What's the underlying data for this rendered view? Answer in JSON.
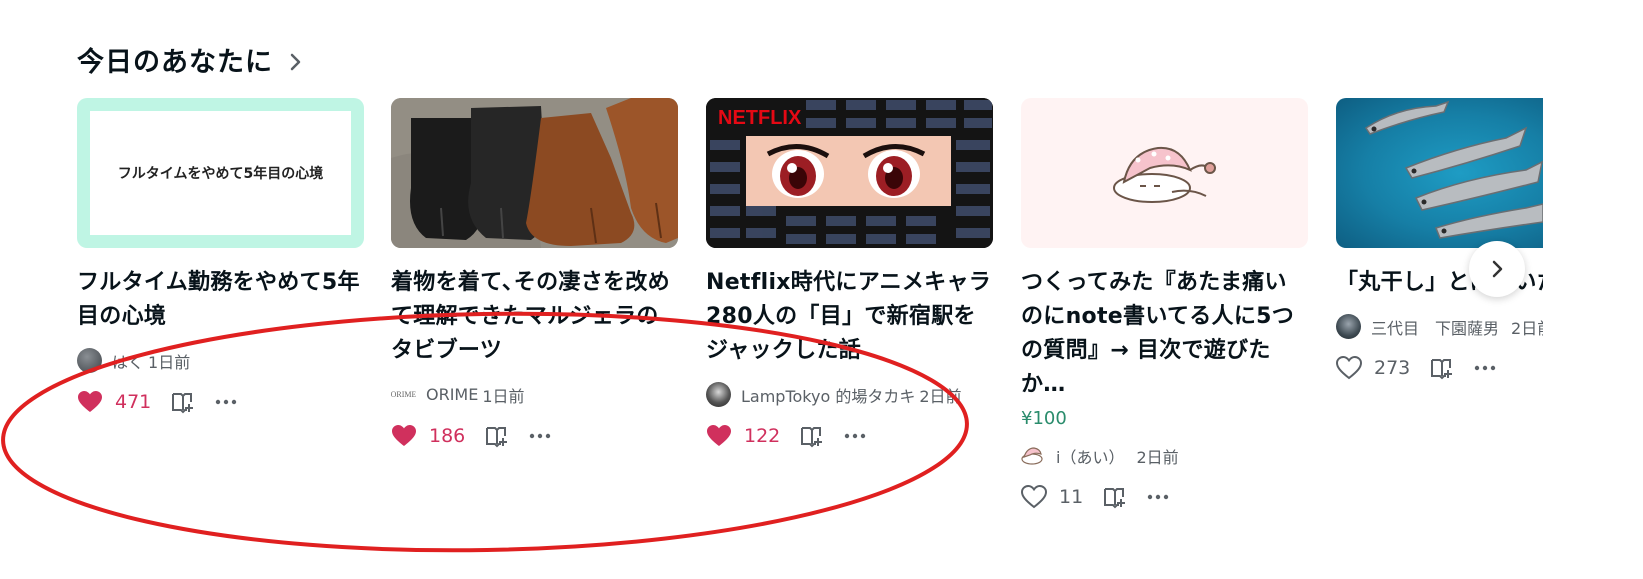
{
  "section": {
    "title": "今日のあなたに"
  },
  "cards": [
    {
      "thumb_text": "フルタイムをやめて5年目の心境",
      "title": "フルタイム勤務をやめて5年目の心境",
      "author": "はく",
      "time": "1日前",
      "likes": "471",
      "liked": true
    },
    {
      "title": "着物を着て､その凄さを改めて理解できたマルジェラのタビブーツ",
      "avatar_text": "ORIME",
      "author": "ORIME",
      "time": "1日前",
      "likes": "186",
      "liked": true
    },
    {
      "thumb_text": "NETFLIX",
      "title": "Netflix時代にアニメキャラ280人の「目」で新宿駅をジャックした話",
      "author": "LampTokyo 的場タカキ",
      "time": "2日前",
      "likes": "122",
      "liked": true
    },
    {
      "title": "つくってみた『あたま痛いのにnote書いてる人に5つの質問』→ 目次で遊びたか…",
      "price": "¥100",
      "author": "i（あい）",
      "time": "2日前",
      "likes": "11",
      "liked": false
    },
    {
      "title": "「丸干し」とは　いたということ",
      "author": "三代目　下園薩男",
      "time": "2日前",
      "likes": "273",
      "liked": false
    }
  ],
  "colors": {
    "like_active": "#d0305d",
    "price": "#2a8c6c",
    "annotation": "#e02020"
  },
  "icons": [
    "chevron-right-icon",
    "heart-icon",
    "magazine-add-icon",
    "more-icon"
  ]
}
